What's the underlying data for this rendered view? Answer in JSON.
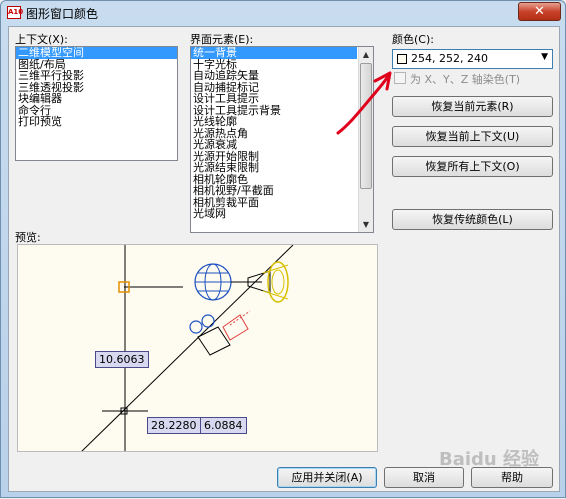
{
  "window": {
    "title": "图形窗口颜色",
    "close_label": "✕",
    "app_icon_text": "A10"
  },
  "context": {
    "label": "上下文(X):",
    "items": [
      "二维模型空间",
      "图纸/布局",
      "三维平行投影",
      "三维透视投影",
      "块编辑器",
      "命令行",
      "打印预览"
    ],
    "selected_index": 0
  },
  "elements": {
    "label": "界面元素(E):",
    "items": [
      "统一背景",
      "十字光标",
      "自动追踪矢量",
      "自动捕捉标记",
      "设计工具提示",
      "设计工具提示背景",
      "光线轮廓",
      "光源热点角",
      "光源衰减",
      "光源开始限制",
      "光源结束限制",
      "相机轮廓色",
      "相机视野/平截面",
      "相机剪裁平面",
      "光域网"
    ],
    "selected_index": 0
  },
  "color": {
    "label": "颜色(C):",
    "value": "254, 252, 240",
    "swatch_color": "#fefcf0"
  },
  "tint": {
    "label": "为 X、Y、Z 轴染色(T)",
    "checked": false,
    "enabled": false
  },
  "buttons": {
    "restore_element": "恢复当前元素(R)",
    "restore_context": "恢复当前上下文(U)",
    "restore_all": "恢复所有上下文(O)",
    "restore_classic": "恢复传统颜色(L)",
    "apply_close": "应用并关闭(A)",
    "cancel": "取消",
    "help": "帮助"
  },
  "preview": {
    "label": "预览:",
    "coord_1": "10.6063",
    "coord_2": "28.2280",
    "coord_3": "6.0884"
  },
  "watermark": "Baidu 经验",
  "annotation_color": "#e0001b"
}
